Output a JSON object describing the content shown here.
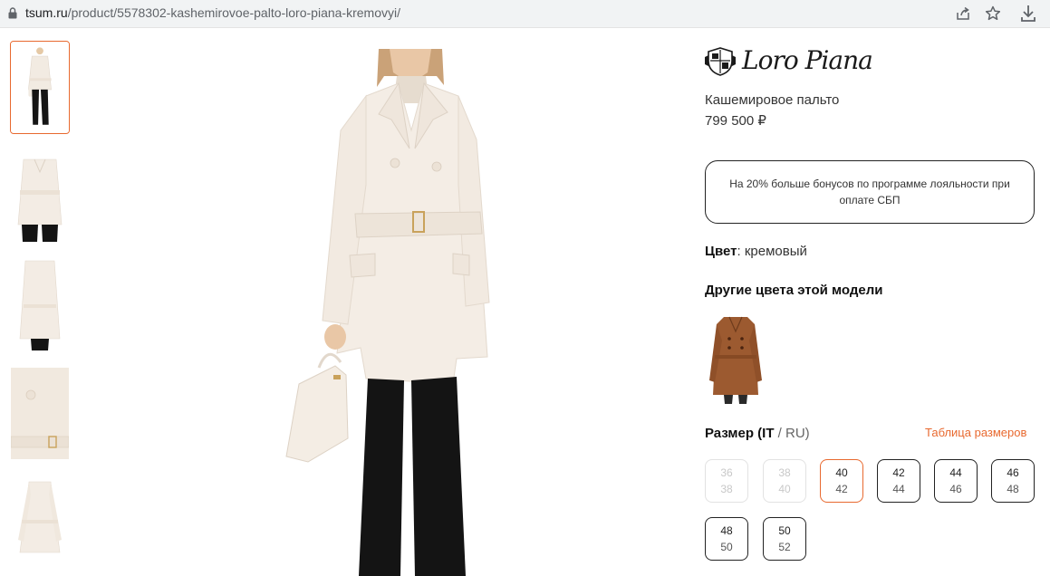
{
  "browser": {
    "url_domain": "tsum.ru",
    "url_path": "/product/5578302-kashemirovoe-palto-loro-piana-kremovyi/"
  },
  "product": {
    "brand": "Loro Piana",
    "name": "Кашемировое пальто",
    "price": "799 500 ₽",
    "bonus_text": "На 20% больше бонусов по программе лояльности при оплате СБП",
    "color_label": "Цвет",
    "color_value": ": кремовый",
    "other_colors_title": "Другие цвета этой модели",
    "size_title": "Размер (IT",
    "size_sep": " / RU)",
    "size_table_link": "Таблица размеров"
  },
  "sizes": [
    {
      "it": "36",
      "ru": "38",
      "state": "disabled"
    },
    {
      "it": "38",
      "ru": "40",
      "state": "disabled"
    },
    {
      "it": "40",
      "ru": "42",
      "state": "selected"
    },
    {
      "it": "42",
      "ru": "44",
      "state": "available"
    },
    {
      "it": "44",
      "ru": "46",
      "state": "available"
    },
    {
      "it": "46",
      "ru": "48",
      "state": "available"
    },
    {
      "it": "48",
      "ru": "50",
      "state": "available"
    },
    {
      "it": "50",
      "ru": "52",
      "state": "available"
    }
  ],
  "colors": {
    "accent": "#e8692f",
    "coat_cream": "#f3ece4",
    "swatch_brown": "#9c5a30"
  },
  "icons": [
    "lock-icon",
    "share-icon",
    "star-icon",
    "download-icon"
  ]
}
